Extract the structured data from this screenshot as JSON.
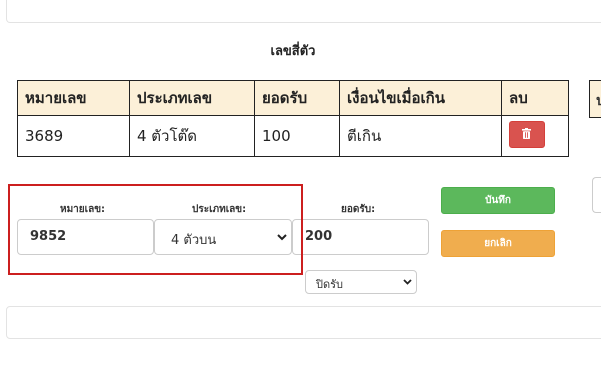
{
  "table": {
    "title": "เลขสี่ตัว",
    "headers": [
      "หมายเลข",
      "ประเภทเลข",
      "ยอดรับ",
      "เงื่อนไขเมื่อเกิน",
      "ลบ"
    ],
    "rows": [
      {
        "number": "3689",
        "type": "4 ตัวโต๊ด",
        "amount": "100",
        "condition": "ตีเกิน"
      }
    ],
    "partial_header_glyph": "ป"
  },
  "form": {
    "number_label": "หมายเลข:",
    "number_value": "9852",
    "type_label": "ประเภทเลข:",
    "type_value": "4 ตัวบน",
    "amount_label": "ยอดรับ:",
    "amount_value": "200",
    "status_value": "ปิดรับ",
    "save_label": "บันทึก",
    "cancel_label": "ยกเลิก"
  },
  "icons": {
    "delete": "trash-icon",
    "dropdown": "chevron-down-icon"
  },
  "colors": {
    "header_bg": "#fcf0d8",
    "delete_button": "#d9534f",
    "save_button": "#5cb85c",
    "cancel_button": "#f0ad4e",
    "highlight_border": "#cc1f1f"
  }
}
